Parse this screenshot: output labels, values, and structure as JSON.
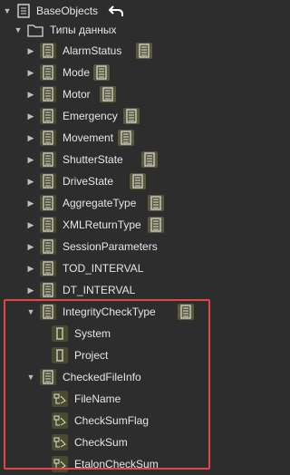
{
  "tree": {
    "root": {
      "label": "BaseObjects",
      "icon": "database-icon",
      "action_icon": "undo-arrow-icon"
    },
    "folder": {
      "label": "Типы данных",
      "icon": "folder-icon"
    },
    "types": [
      {
        "label": "AlarmStatus"
      },
      {
        "label": "Mode"
      },
      {
        "label": "Motor"
      },
      {
        "label": "Emergency"
      },
      {
        "label": "Movement"
      },
      {
        "label": "ShutterState"
      },
      {
        "label": "DriveState"
      },
      {
        "label": "AggregateType"
      },
      {
        "label": "XMLReturnType"
      },
      {
        "label": "SessionParameters"
      },
      {
        "label": "TOD_INTERVAL"
      },
      {
        "label": "DT_INTERVAL"
      },
      {
        "label": "IntegrityCheckType"
      },
      {
        "label": "CheckedFileInfo"
      }
    ],
    "integrity_children": [
      {
        "label": "System"
      },
      {
        "label": "Project"
      }
    ],
    "checked_children": [
      {
        "label": "FileName"
      },
      {
        "label": "CheckSumFlag"
      },
      {
        "label": "CheckSum"
      },
      {
        "label": "EtalonCheckSum"
      }
    ]
  },
  "colors": {
    "background": "#2d2d2d",
    "icon_bg": "#4a4a2c",
    "highlight_border": "#e04848"
  }
}
